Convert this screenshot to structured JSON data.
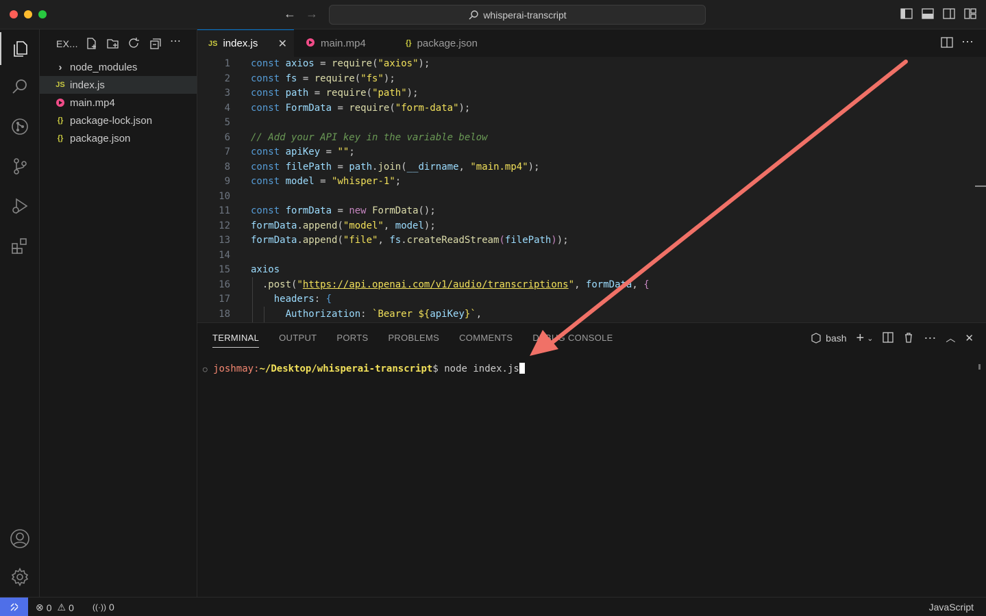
{
  "titlebar": {
    "search_text": "whisperai-transcript",
    "back_icon": "arrow-left-icon",
    "forward_icon": "arrow-right-icon"
  },
  "sidebar": {
    "title": "EX...",
    "items": [
      {
        "label": "node_modules",
        "icon": "chevron-right-icon"
      },
      {
        "label": "index.js",
        "icon": "js-file-icon",
        "icon_text": "JS",
        "icon_color": "#cbcb41"
      },
      {
        "label": "main.mp4",
        "icon": "video-file-icon",
        "icon_color": "#f14c88"
      },
      {
        "label": "package-lock.json",
        "icon": "json-file-icon",
        "icon_text": "{}",
        "icon_color": "#cbcb41"
      },
      {
        "label": "package.json",
        "icon": "json-file-icon",
        "icon_text": "{}",
        "icon_color": "#cbcb41"
      }
    ]
  },
  "tabs": [
    {
      "label": "index.js",
      "icon_text": "JS",
      "active": true
    },
    {
      "label": "main.mp4",
      "active": false
    },
    {
      "label": "package.json",
      "icon_text": "{}",
      "active": false
    }
  ],
  "editor": {
    "line_numbers": [
      "1",
      "2",
      "3",
      "4",
      "5",
      "6",
      "7",
      "8",
      "9",
      "10",
      "11",
      "12",
      "13",
      "14",
      "15",
      "16",
      "17",
      "18"
    ]
  },
  "panel": {
    "tabs": [
      "TERMINAL",
      "OUTPUT",
      "PORTS",
      "PROBLEMS",
      "COMMENTS",
      "DEBUG CONSOLE"
    ],
    "shell_label": "bash",
    "terminal": {
      "user": "joshmay:",
      "path": "~/Desktop/whisperai-transcript",
      "prompt": "$ ",
      "command": "node index.js"
    }
  },
  "statusbar": {
    "errors": "0",
    "warnings": "0",
    "ports": "0",
    "language": "JavaScript"
  },
  "colors": {
    "accent": "#0078d4",
    "remote": "#4f6fe8",
    "annotation_arrow": "#f07167"
  }
}
